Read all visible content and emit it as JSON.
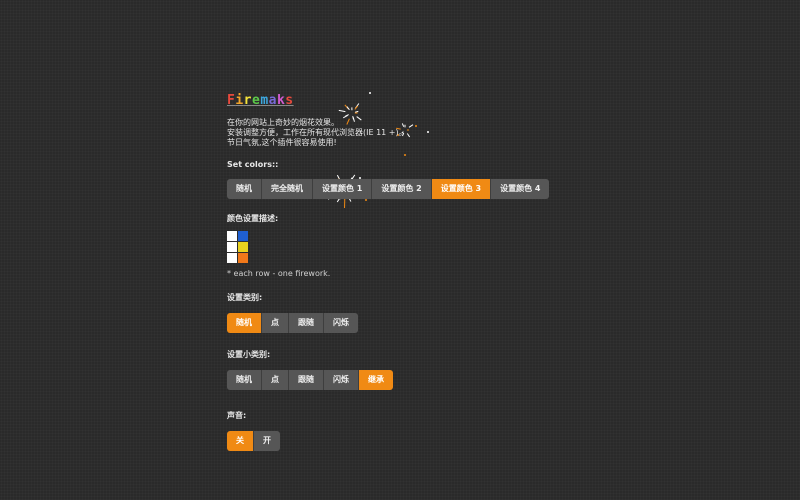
{
  "logo": {
    "text": "Firemaks",
    "letter_colors": [
      "#e8493d",
      "#f2a52b",
      "#f5e43b",
      "#5cc94a",
      "#3da8e0",
      "#7a6ad8",
      "#d25bd1",
      "#e8493d"
    ]
  },
  "description": [
    "在你的网站上奇妙的烟花效果。",
    "安装调整方便，工作在所有现代浏览器(IE 11 +)。",
    "节日气氛,这个插件很容易使用!"
  ],
  "colors_section": {
    "title": "Set colors::",
    "buttons": [
      "随机",
      "完全随机",
      "设置颜色 1",
      "设置颜色 2",
      "设置颜色 3",
      "设置颜色 4"
    ],
    "active_index": 4
  },
  "color_desc": {
    "title": "颜色设置描述:",
    "swatches": [
      [
        "#ffffff",
        "#1f5fd1"
      ],
      [
        "#ffffff",
        "#e8d21f"
      ],
      [
        "#ffffff",
        "#f0781a"
      ]
    ],
    "note": "* each row - one firework."
  },
  "type_section": {
    "title": "设置类别:",
    "buttons": [
      "随机",
      "点",
      "跟随",
      "闪烁"
    ],
    "active_index": 0
  },
  "subtype_section": {
    "title": "设置小类别:",
    "buttons": [
      "随机",
      "点",
      "跟随",
      "闪烁",
      "继承"
    ],
    "active_index": 4
  },
  "sound_section": {
    "title": "声音:",
    "buttons": [
      "关",
      "开"
    ],
    "active_index": 0
  },
  "colors": {
    "accent": "#f08a14",
    "button": "#565656",
    "background": "#2a2a2a"
  }
}
